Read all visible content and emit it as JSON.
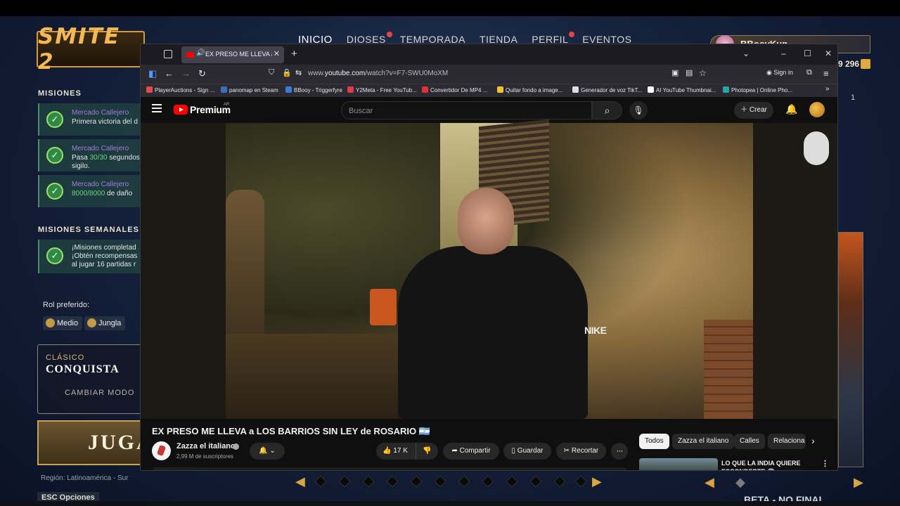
{
  "game": {
    "logo": "SMITE 2",
    "nav": [
      "INICIO",
      "DIOSES",
      "TEMPORADA",
      "TIENDA",
      "PERFIL",
      "EVENTOS"
    ],
    "username": "BBooyKun",
    "currency": "9 296",
    "side_count": "1",
    "missions_title": "MISIONES",
    "missions": [
      {
        "title": "Mercado Callejero",
        "desc": "Primera victoria del d"
      },
      {
        "title": "Mercado Callejero",
        "desc_pre": "Pasa ",
        "desc_hl": "30/30",
        "desc_post": " segundos",
        "desc2": "sigilo."
      },
      {
        "title": "Mercado Callejero",
        "desc_hl": "8000/8000",
        "desc_post": " de daño"
      }
    ],
    "weekly_title": "MISIONES SEMANALES",
    "weekly": {
      "line1": "¡Misiones completad",
      "line2": "¡Obtén recompensas",
      "line3": "al jugar 16 partidas r"
    },
    "rol_label": "Rol preferido:",
    "roles": [
      "Medio",
      "Jungla"
    ],
    "mode_kicker": "CLÁSICO",
    "mode_name": "CONQUISTA",
    "mode_change": "CAMBIAR MODO",
    "play": "JUGA",
    "region": "Región: Latinoamérica - Sur",
    "esc": "ESC  Opciones",
    "beta": "BETA - NO FINAL"
  },
  "browser": {
    "tab_title": "EX PRESO ME LLEVA a LOS",
    "url_prefix": "www.",
    "url_domain": "youtube.com",
    "url_path": "/watch?v=F7-SWU0MoXM",
    "signin": "Sign in",
    "bookmarks": [
      {
        "label": "PlayerAuctions - Sign ...",
        "color": "#e14b4b"
      },
      {
        "label": "panomap en Steam",
        "color": "#3d6fb3"
      },
      {
        "label": "BBooy - Triggerfyre",
        "color": "#3a7bd5"
      },
      {
        "label": "Y2Meta - Free YouTub...",
        "color": "#e0394a"
      },
      {
        "label": "Convertidor De MP4 ...",
        "color": "#d33"
      },
      {
        "label": "Quitar fondo a image...",
        "color": "#f2c230"
      },
      {
        "label": "Generador de voz TikT...",
        "color": "#dddddd"
      },
      {
        "label": "AI YouTube Thumbnai...",
        "color": "#ffffff"
      },
      {
        "label": "Photopea | Online Pho...",
        "color": "#2aa6a0"
      }
    ]
  },
  "youtube": {
    "brand": "Premium",
    "country": "AR",
    "search_placeholder": "Buscar",
    "create": "Crear",
    "video_title": "EX PRESO ME LLEVA a LOS BARRIOS SIN LEY de ROSARIO 🇦🇷",
    "channel": "Zazza el italiano",
    "subscribers": "2,99 M de suscriptores",
    "likes": "17 K",
    "share": "Compartir",
    "save": "Guardar",
    "clip": "Recortar",
    "video_overlay_text": "NIKE",
    "chips": [
      "Todos",
      "Zazza el italiano",
      "Calles",
      "Relaciona"
    ],
    "rec_title": "LO QUE LA INDIA QUIERE ESCONDERTE 😱"
  }
}
